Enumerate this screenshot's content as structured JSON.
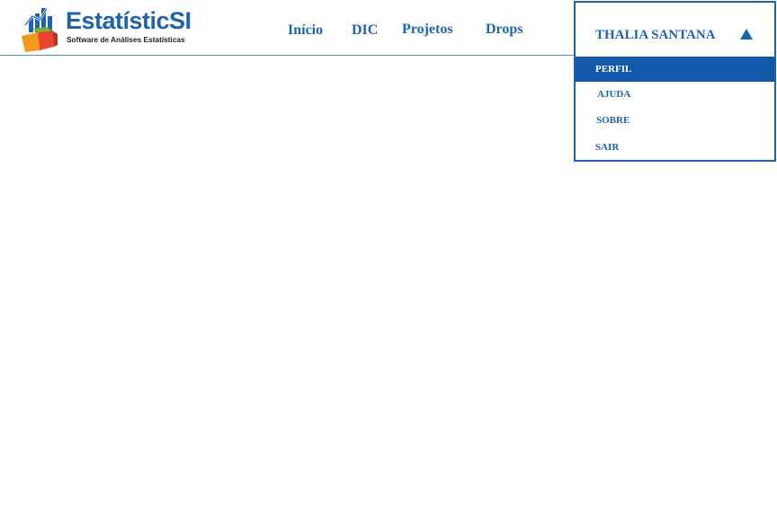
{
  "logo": {
    "title": "EstatísticSI",
    "subtitle": "Software de Análises Estatísticas"
  },
  "nav": {
    "items": [
      {
        "label": "Início"
      },
      {
        "label": "DIC"
      },
      {
        "label": "Projetos"
      },
      {
        "label": "Drops"
      }
    ]
  },
  "user_menu": {
    "name": "THALIA SANTANA",
    "caret_icon": "triangle-up-icon",
    "expanded": true,
    "items": [
      {
        "label": "PERFIL",
        "active": true
      },
      {
        "label": "AJUDA"
      },
      {
        "label": "SOBRE"
      },
      {
        "label": "SAIR"
      }
    ]
  },
  "colors": {
    "brand_blue": "#1f63ad",
    "active_item_bg": "#1259aa",
    "header_line": "#5b8fd1",
    "logo_orange": "#f39a1e",
    "logo_red": "#e8452c",
    "logo_green": "#76b82a"
  }
}
